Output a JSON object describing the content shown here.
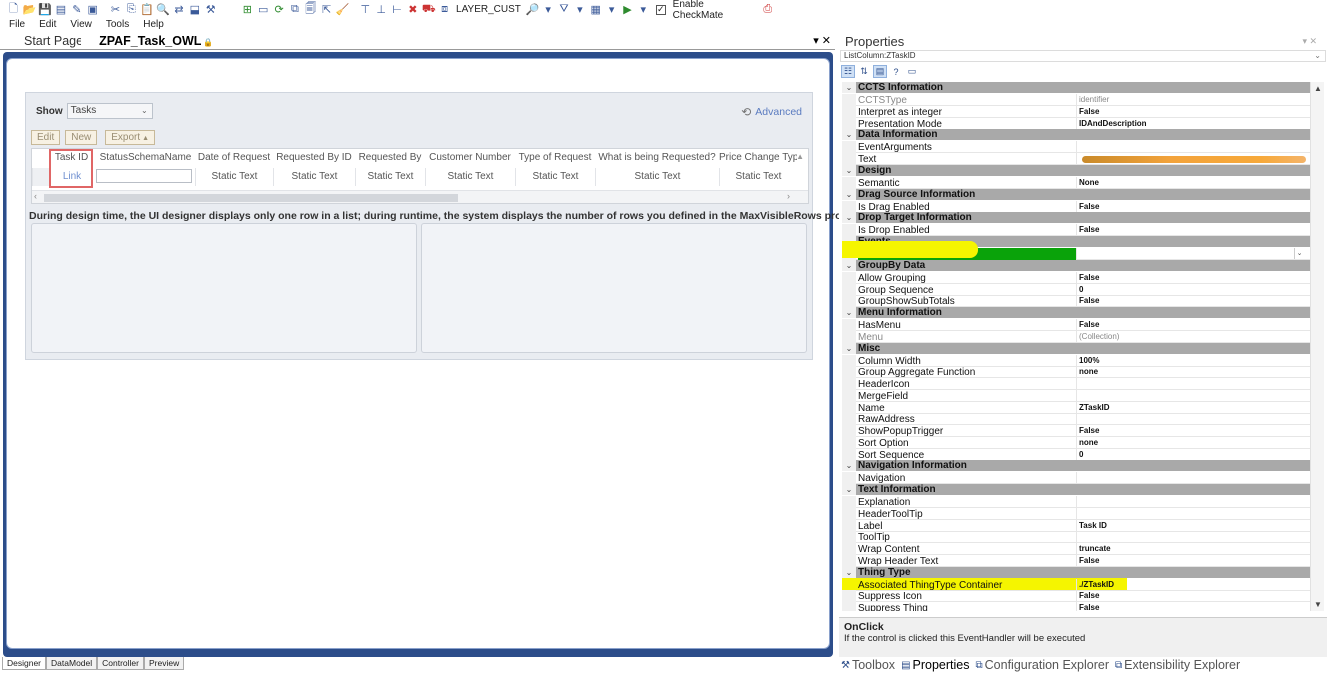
{
  "toolbar": {
    "layer_label": "LAYER_CUST",
    "checkmate_label": "Enable CheckMate",
    "checkmate_checked": true
  },
  "menu": [
    "File",
    "Edit",
    "View",
    "Tools",
    "Help"
  ],
  "doc_tabs": [
    {
      "label": "Start Page",
      "active": false
    },
    {
      "label": "ZPAF_Task_OWL",
      "active": true
    }
  ],
  "designer": {
    "show_label": "Show",
    "show_value": "Tasks",
    "advanced_label": "Advanced",
    "buttons": [
      "Edit",
      "New",
      "Export"
    ],
    "columns": [
      {
        "header": "Task ID",
        "cell": "Link"
      },
      {
        "header": "StatusSchemaName",
        "cell": ""
      },
      {
        "header": "Date of Request",
        "cell": "Static Text"
      },
      {
        "header": "Requested By ID",
        "cell": "Static Text"
      },
      {
        "header": "Requested By",
        "cell": "Static Text"
      },
      {
        "header": "Customer Number",
        "cell": "Static Text"
      },
      {
        "header": "Type of Request",
        "cell": "Static Text"
      },
      {
        "header": "What is being Requested?",
        "cell": "Static Text"
      },
      {
        "header": "Price Change Typ",
        "cell": "Static Text"
      }
    ],
    "note": "During design time, the UI designer displays only one row in a list; during runtime, the system displays the number of rows you defined in the MaxVisibleRows property."
  },
  "bottom_tabs": [
    {
      "label": "Designer",
      "active": true
    },
    {
      "label": "DataModel",
      "active": false
    },
    {
      "label": "Controller",
      "active": false
    },
    {
      "label": "Preview",
      "active": false
    }
  ],
  "properties": {
    "title": "Properties",
    "object": "ListColumn:ZTaskID",
    "categories": [
      {
        "name": "CCTS Information",
        "rows": [
          {
            "name": "CCTSType",
            "value": "identifier",
            "dim": true
          },
          {
            "name": "Interpret as integer",
            "value": "False"
          },
          {
            "name": "Presentation Mode",
            "value": "IDAndDescription"
          }
        ]
      },
      {
        "name": "Data Information",
        "rows": [
          {
            "name": "EventArguments",
            "value": ""
          },
          {
            "name": "Text",
            "value": "",
            "redacted": true
          }
        ]
      },
      {
        "name": "Design",
        "rows": [
          {
            "name": "Semantic",
            "value": "None"
          }
        ]
      },
      {
        "name": "Drag Source Information",
        "rows": [
          {
            "name": "Is Drag Enabled",
            "value": "False"
          }
        ]
      },
      {
        "name": "Drop Target Information",
        "rows": [
          {
            "name": "Is Drop Enabled",
            "value": "False"
          }
        ]
      },
      {
        "name": "Events",
        "rows": [
          {
            "name": "OnClick",
            "value": "",
            "highlight": "onclick"
          }
        ]
      },
      {
        "name": "GroupBy Data",
        "rows": [
          {
            "name": "Allow Grouping",
            "value": "False"
          },
          {
            "name": "Group Sequence",
            "value": "0"
          },
          {
            "name": "GroupShowSubTotals",
            "value": "False"
          }
        ]
      },
      {
        "name": "Menu Information",
        "rows": [
          {
            "name": "HasMenu",
            "value": "False"
          },
          {
            "name": "Menu",
            "value": "(Collection)",
            "dim": true
          }
        ]
      },
      {
        "name": "Misc",
        "rows": [
          {
            "name": "Column Width",
            "value": "100%"
          },
          {
            "name": "Group Aggregate Function",
            "value": "none"
          },
          {
            "name": "HeaderIcon",
            "value": ""
          },
          {
            "name": "MergeField",
            "value": ""
          },
          {
            "name": "Name",
            "value": "ZTaskID"
          },
          {
            "name": "RawAddress",
            "value": ""
          },
          {
            "name": "ShowPopupTrigger",
            "value": "False"
          },
          {
            "name": "Sort Option",
            "value": "none"
          },
          {
            "name": "Sort Sequence",
            "value": "0"
          }
        ]
      },
      {
        "name": "Navigation Information",
        "rows": [
          {
            "name": "Navigation",
            "value": ""
          }
        ]
      },
      {
        "name": "Text Information",
        "rows": [
          {
            "name": "Explanation",
            "value": ""
          },
          {
            "name": "HeaderToolTip",
            "value": ""
          },
          {
            "name": "Label",
            "value": "Task ID"
          },
          {
            "name": "ToolTip",
            "value": ""
          },
          {
            "name": "Wrap Content",
            "value": "truncate"
          },
          {
            "name": "Wrap Header Text",
            "value": "False"
          }
        ]
      },
      {
        "name": "Thing Type",
        "rows": [
          {
            "name": "Associated ThingType Container",
            "value": "./ZTaskID",
            "highlight": "yellow"
          },
          {
            "name": "Suppress Icon",
            "value": "False"
          },
          {
            "name": "Suppress Thing",
            "value": "False"
          }
        ]
      }
    ],
    "description_title": "OnClick",
    "description_text": "If the control is clicked this EventHandler will be executed",
    "tabs": [
      {
        "label": "Toolbox",
        "active": false
      },
      {
        "label": "Properties",
        "active": true
      },
      {
        "label": "Configuration Explorer",
        "active": false
      },
      {
        "label": "Extensibility Explorer",
        "active": false
      }
    ]
  },
  "colors": {
    "designer_frame": "#2c4d8a",
    "onclick_green": "#0aa30a",
    "highlight_yellow": "#f5f500",
    "category_gray": "#a9a9a9"
  }
}
